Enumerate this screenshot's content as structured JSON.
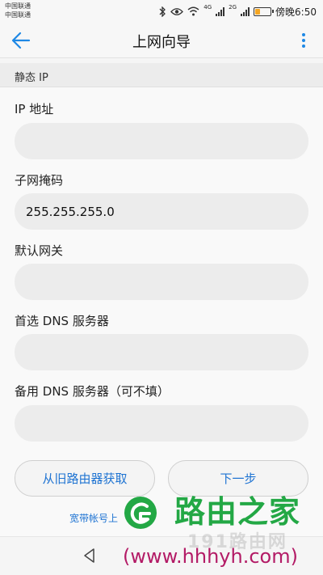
{
  "statusbar": {
    "carrier_1": "中国联通",
    "carrier_2": "中国联通",
    "net_tag_1": "4G",
    "net_tag_2": "2G",
    "time": "傍晚6:50",
    "battery_level": 0.35,
    "battery_color": "#f5a623",
    "icons": [
      "bluetooth-icon",
      "eye-icon",
      "wifi-icon",
      "signal-icon",
      "battery-icon"
    ]
  },
  "appbar": {
    "title": "上网向导",
    "accent_color": "#1e88e5"
  },
  "section": {
    "title": "静态 IP"
  },
  "fields": [
    {
      "label": "IP 地址",
      "value": ""
    },
    {
      "label": "子网掩码",
      "value": "255.255.255.0"
    },
    {
      "label": "默认网关",
      "value": ""
    },
    {
      "label": "首选 DNS 服务器",
      "value": ""
    },
    {
      "label": "备用 DNS 服务器（可不填）",
      "value": ""
    }
  ],
  "buttons": {
    "fetch_label": "从旧路由器获取",
    "next_label": "下一步"
  },
  "footer": {
    "link_text": "宽带帐号上"
  },
  "watermark": {
    "title": "路由之家",
    "ghost": "191路由网",
    "url": "(www.hhhyh.com)",
    "title_color": "#23a845",
    "url_color": "#b31b66"
  }
}
